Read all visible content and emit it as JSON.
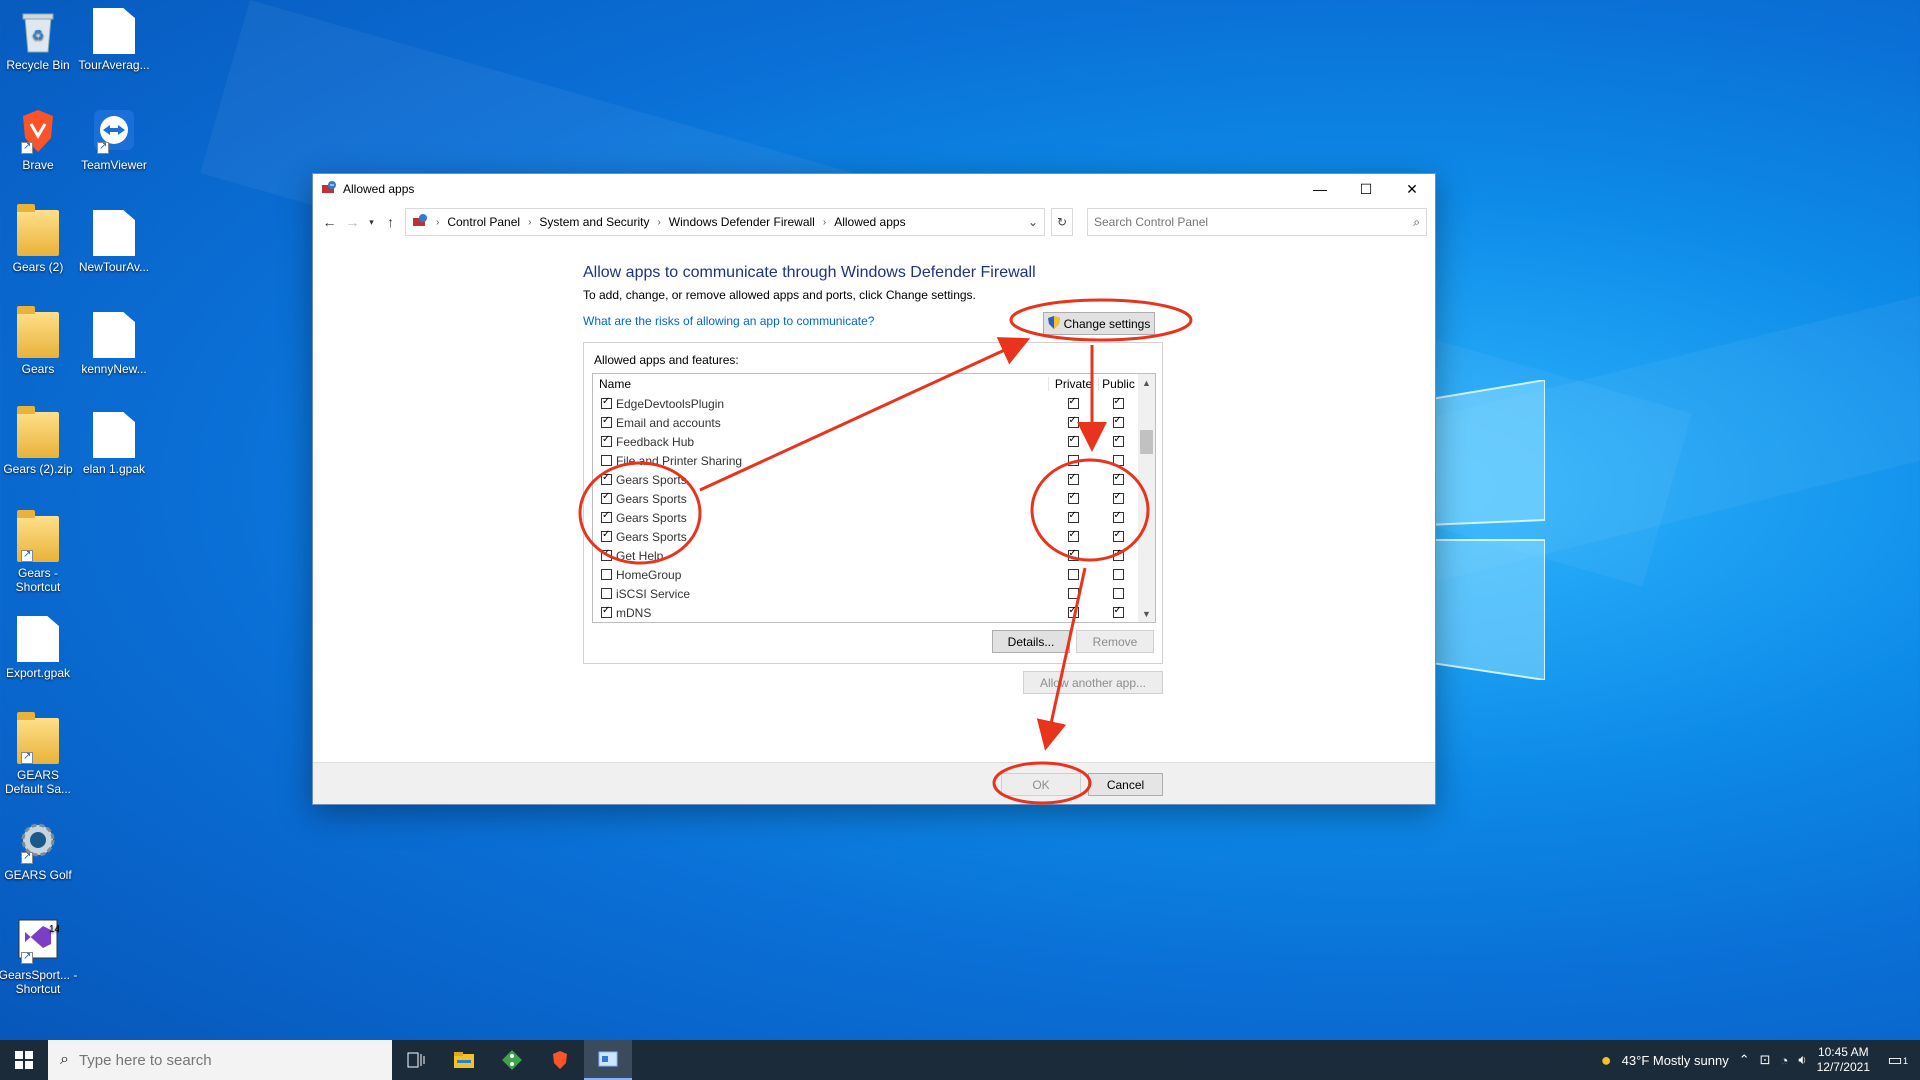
{
  "desktop": {
    "icons": [
      {
        "label": "Recycle Bin"
      },
      {
        "label": "TourAverag..."
      },
      {
        "label": "Brave"
      },
      {
        "label": "TeamViewer"
      },
      {
        "label": "Gears (2)"
      },
      {
        "label": "NewTourAv..."
      },
      {
        "label": "Gears"
      },
      {
        "label": "kennyNew..."
      },
      {
        "label": "Gears (2).zip"
      },
      {
        "label": "elan 1.gpak"
      },
      {
        "label": "Gears - Shortcut"
      },
      {
        "label": "Export.gpak"
      },
      {
        "label": "GEARS Default Sa..."
      },
      {
        "label": "GEARS Golf"
      },
      {
        "label": "GearsSport... - Shortcut"
      }
    ]
  },
  "window": {
    "title": "Allowed apps",
    "address": {
      "crumbs": [
        "Control Panel",
        "System and Security",
        "Windows Defender Firewall",
        "Allowed apps"
      ]
    },
    "search_placeholder": "Search Control Panel",
    "heading": "Allow apps to communicate through Windows Defender Firewall",
    "subtext": "To add, change, or remove allowed apps and ports, click Change settings.",
    "risk_link": "What are the risks of allowing an app to communicate?",
    "change_settings_label": "Change settings",
    "group_title": "Allowed apps and features:",
    "columns": {
      "name": "Name",
      "private": "Private",
      "public": "Public"
    },
    "rows": [
      {
        "name": "EdgeDevtoolsPlugin",
        "checked": true,
        "private": true,
        "public": true
      },
      {
        "name": "Email and accounts",
        "checked": true,
        "private": true,
        "public": true
      },
      {
        "name": "Feedback Hub",
        "checked": true,
        "private": true,
        "public": true
      },
      {
        "name": "File and Printer Sharing",
        "checked": false,
        "private": false,
        "public": false
      },
      {
        "name": "Gears Sports",
        "checked": true,
        "private": true,
        "public": true
      },
      {
        "name": "Gears Sports",
        "checked": true,
        "private": true,
        "public": true
      },
      {
        "name": "Gears Sports",
        "checked": true,
        "private": true,
        "public": true
      },
      {
        "name": "Gears Sports",
        "checked": true,
        "private": true,
        "public": true
      },
      {
        "name": "Get Help",
        "checked": true,
        "private": true,
        "public": true
      },
      {
        "name": "HomeGroup",
        "checked": false,
        "private": false,
        "public": false
      },
      {
        "name": "iSCSI Service",
        "checked": false,
        "private": false,
        "public": false
      },
      {
        "name": "mDNS",
        "checked": true,
        "private": true,
        "public": true
      }
    ],
    "details_label": "Details...",
    "remove_label": "Remove",
    "allow_another_label": "Allow another app...",
    "ok_label": "OK",
    "cancel_label": "Cancel"
  },
  "taskbar": {
    "search_placeholder": "Type here to search",
    "weather": "43°F  Mostly sunny",
    "time": "10:45 AM",
    "date": "12/7/2021",
    "notification_count": "1"
  },
  "annotation_color": "#e8341c"
}
